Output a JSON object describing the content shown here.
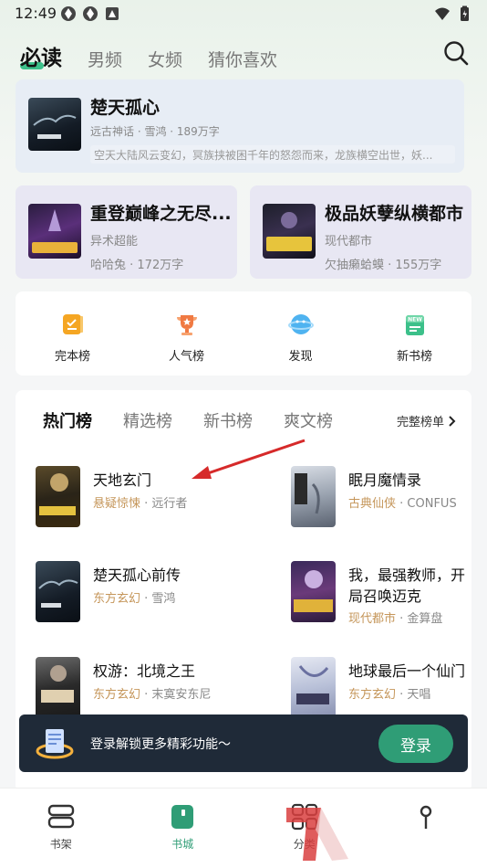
{
  "status_bar": {
    "time": "12:49"
  },
  "top_tabs": [
    "必读",
    "男频",
    "女频",
    "猜你喜欢"
  ],
  "featured": {
    "title": "楚天孤心",
    "meta": "远古神话 · 雪鸿 · 189万字",
    "desc": "空天大陆风云变幻，冥族挟被困千年的怒怨而来，龙族横空出世，妖..."
  },
  "cards": [
    {
      "title": "重登巅峰之无尽...",
      "genre": "异术超能",
      "meta": "哈哈兔 · 172万字"
    },
    {
      "title": "极品妖孽纵横都市",
      "genre": "现代都市",
      "meta": "欠抽癞蛤蟆 · 155万字"
    }
  ],
  "quick_nav": [
    {
      "label": "完本榜",
      "icon": "finished-list-icon"
    },
    {
      "label": "人气榜",
      "icon": "trophy-icon"
    },
    {
      "label": "发现",
      "icon": "planet-icon"
    },
    {
      "label": "新书榜",
      "icon": "new-book-icon"
    }
  ],
  "rank": {
    "tabs": [
      "热门榜",
      "精选榜",
      "新书榜",
      "爽文榜"
    ],
    "more_label": "完整榜单",
    "books": [
      {
        "title": "天地玄门",
        "genre": "悬疑惊悚",
        "author": "远行者"
      },
      {
        "title": "眠月魔情录",
        "genre": "古典仙侠",
        "author": "CONFUS"
      },
      {
        "title": "楚天孤心前传",
        "genre": "东方玄幻",
        "author": "雪鸿"
      },
      {
        "title": "我，最强教师，开",
        "title2": "局召唤迈克",
        "genre": "现代都市",
        "author": "金算盘"
      },
      {
        "title": "权游：北境之王",
        "genre": "东方玄幻",
        "author": "末寞安东尼"
      },
      {
        "title": "地球最后一个仙门",
        "genre": "东方玄幻",
        "author": "天唱"
      }
    ]
  },
  "login_banner": {
    "text": "登录解锁更多精彩功能～",
    "button": "登录"
  },
  "bottom_nav": [
    {
      "label": "书架",
      "icon": "bookshelf-icon"
    },
    {
      "label": "书城",
      "icon": "bookstore-icon"
    },
    {
      "label": "分类",
      "icon": "category-icon"
    },
    {
      "label": "",
      "icon": "profile-icon"
    }
  ],
  "colors": {
    "accent": "#2f9d76",
    "genre": "#c5965a",
    "arrow": "#d62a2a"
  }
}
